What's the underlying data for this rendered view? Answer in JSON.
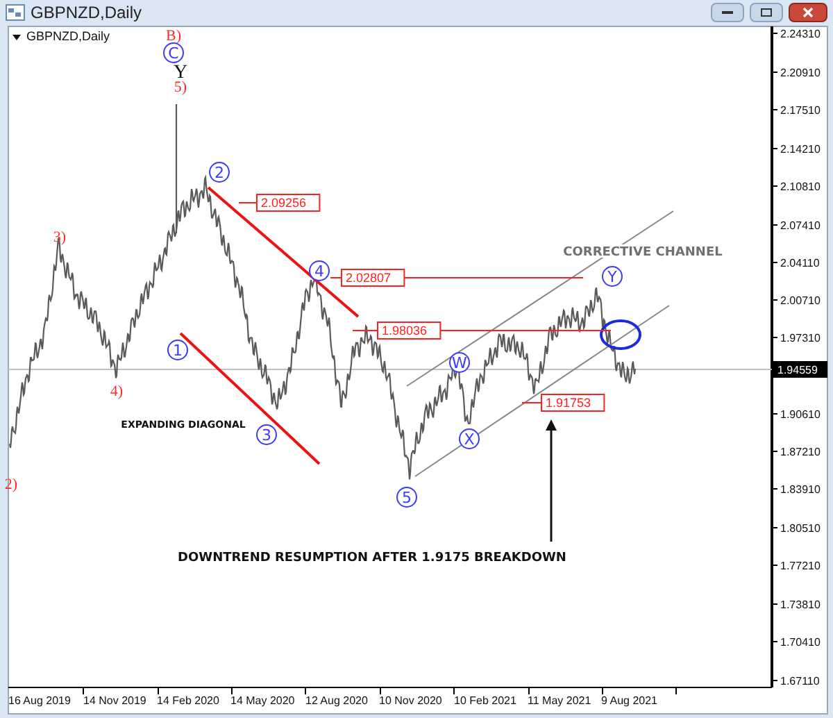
{
  "window": {
    "title": "GBPNZD,Daily"
  },
  "chart": {
    "title": "GBPNZD,Daily",
    "price_axis": [
      "2.24310",
      "2.20910",
      "2.17510",
      "2.14210",
      "2.10810",
      "2.07410",
      "2.04110",
      "2.00710",
      "1.97310",
      "1.90610",
      "1.87210",
      "1.83910",
      "1.80510",
      "1.77210",
      "1.73810",
      "1.70410",
      "1.67110"
    ],
    "current_price": "1.94559",
    "time_axis": [
      "16 Aug 2019",
      "14 Nov 2019",
      "14 Feb 2020",
      "14 May 2020",
      "12 Aug 2020",
      "10 Nov 2020",
      "10 Feb 2021",
      "11 May 2021",
      "9 Aug 2021"
    ],
    "wave_labels": [
      {
        "text": "B)",
        "kind": "paren"
      },
      {
        "text": "C",
        "kind": "circled"
      },
      {
        "text": "Y",
        "kind": "letter"
      },
      {
        "text": "5)",
        "kind": "paren"
      },
      {
        "text": "3)",
        "kind": "paren"
      },
      {
        "text": "4)",
        "kind": "paren"
      },
      {
        "text": "2)",
        "kind": "paren"
      },
      {
        "text": "1",
        "kind": "circled"
      },
      {
        "text": "2",
        "kind": "circled"
      },
      {
        "text": "3",
        "kind": "circled"
      },
      {
        "text": "4",
        "kind": "circled"
      },
      {
        "text": "5",
        "kind": "circled"
      },
      {
        "text": "W",
        "kind": "circled"
      },
      {
        "text": "X",
        "kind": "circled"
      },
      {
        "text": "Y",
        "kind": "circled"
      }
    ],
    "price_levels": [
      {
        "text": "2.09256"
      },
      {
        "text": "2.02807"
      },
      {
        "text": "1.98036"
      },
      {
        "text": "1.91753"
      }
    ],
    "captions": [
      {
        "text": "CORRECTIVE CHANNEL"
      },
      {
        "text": "EXPANDING DIAGONAL"
      },
      {
        "text": "DOWNTREND RESUMPTION AFTER 1.9175 BREAKDOWN"
      }
    ]
  }
}
